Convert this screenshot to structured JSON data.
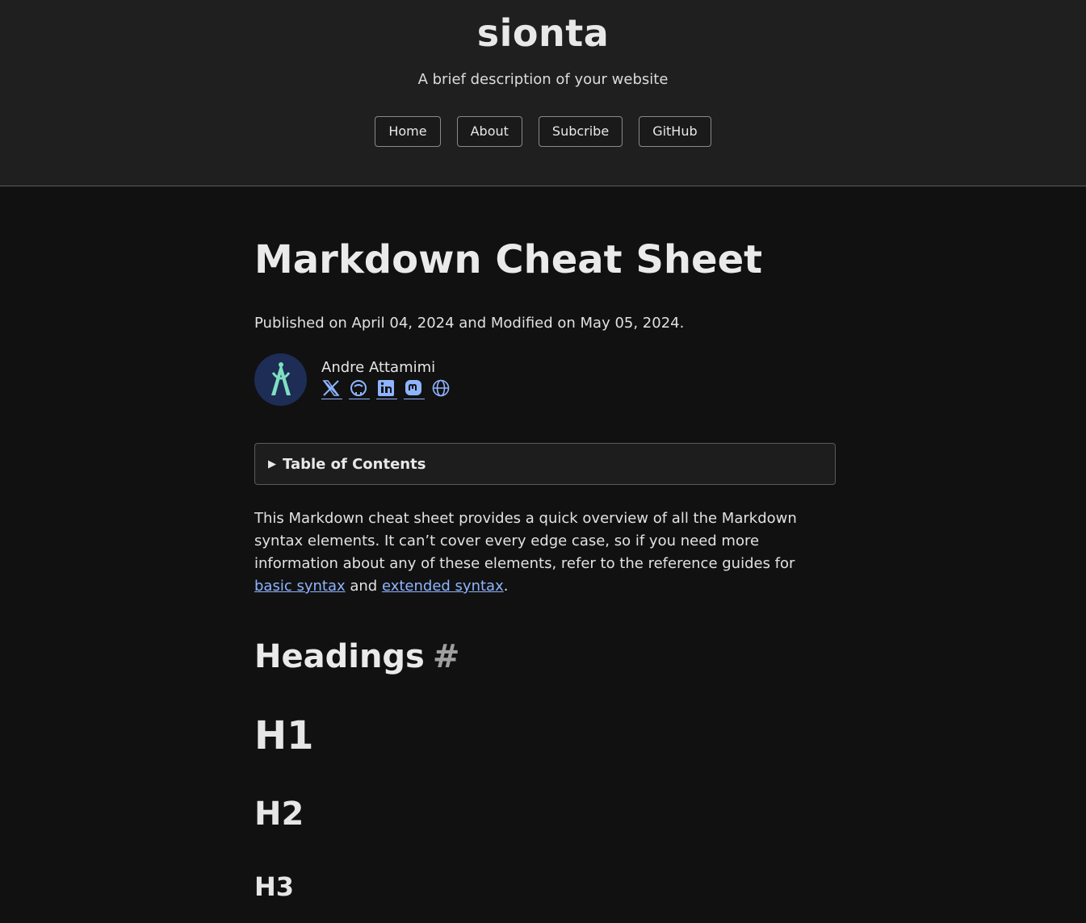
{
  "site": {
    "title": "sionta",
    "description": "A brief description of your website"
  },
  "nav": {
    "items": [
      "Home",
      "About",
      "Subcribe",
      "GitHub"
    ]
  },
  "article": {
    "title": "Markdown Cheat Sheet",
    "published": "Published on April 04, 2024 and Modified on May 05, 2024.",
    "author": "Andre Attamimi",
    "social_icons": [
      "x-icon",
      "github-icon",
      "linkedin-icon",
      "mastodon-icon",
      "globe-icon"
    ],
    "toc_label": "Table of Contents",
    "intro_text": "This Markdown cheat sheet provides a quick overview of all the Markdown syntax elements. It can’t cover every edge case, so if you need more information about any of these elements, refer to the reference guides for ",
    "link_basic": "basic syntax",
    "intro_and": " and ",
    "link_extended": "extended syntax",
    "intro_end": ".",
    "section_heading": "Headings",
    "section_anchor": "#",
    "h1": "H1",
    "h2": "H2",
    "h3": "H3"
  },
  "colors": {
    "background": "#111111",
    "header_bg": "#1f1f1f",
    "link": "#8fb4ff",
    "avatar_bg": "#1e2d55",
    "avatar_accent": "#7fe0c0"
  }
}
